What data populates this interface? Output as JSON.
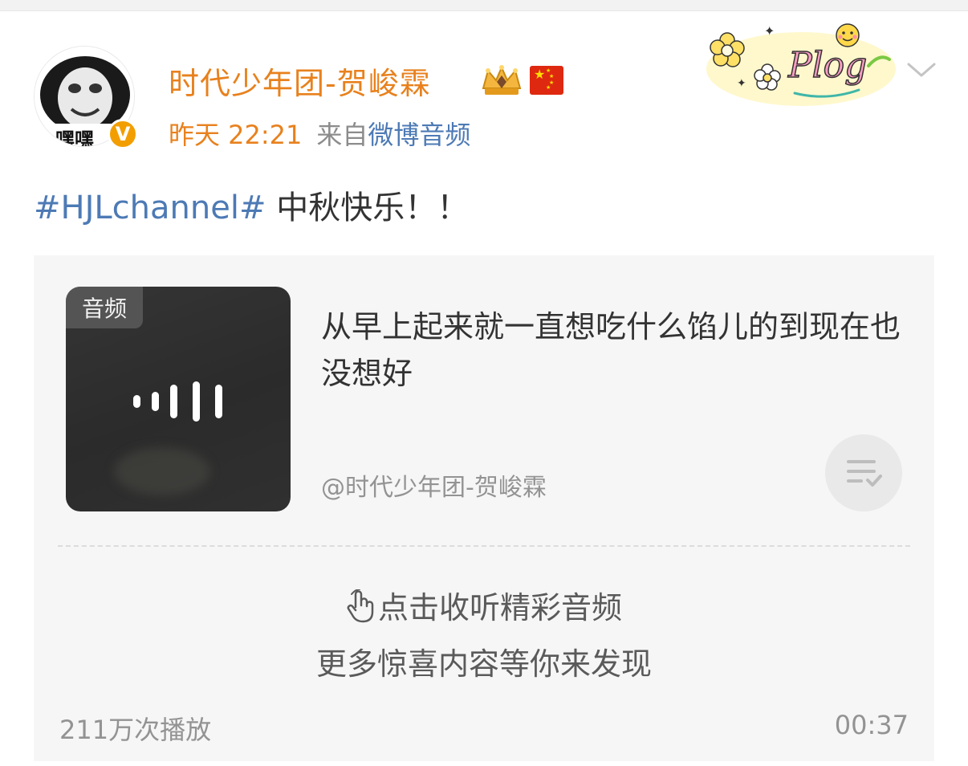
{
  "post": {
    "username": "时代少年团-贺峻霖",
    "avatar_caption": "嘿嘿",
    "verified_badge": "V",
    "time": "昨天 22:21",
    "source_prefix": "来自",
    "source_name": "微博音频",
    "hashtag": "#HJLchannel#",
    "text": " 中秋快乐！！",
    "sticker_text": "Plog"
  },
  "audio_card": {
    "cover_badge": "音频",
    "title": "从早上起来就一直想吃什么馅儿的到现在也没想好",
    "author": "@时代少年团-贺峻霖",
    "cta_line1": "点击收听精彩音频",
    "cta_line2": "更多惊喜内容等你来发现",
    "play_count": "211万次播放",
    "duration": "00:37"
  },
  "colors": {
    "name_orange": "#e8811d",
    "link_blue": "#4d7ab5",
    "card_bg": "#f6f6f6",
    "verified_orange": "#f29e00"
  },
  "icons": [
    "crown-icon",
    "china-flag-icon",
    "chevron-down-icon",
    "sound-wave-icon",
    "playlist-check-icon",
    "tap-hand-icon",
    "verified-icon"
  ]
}
